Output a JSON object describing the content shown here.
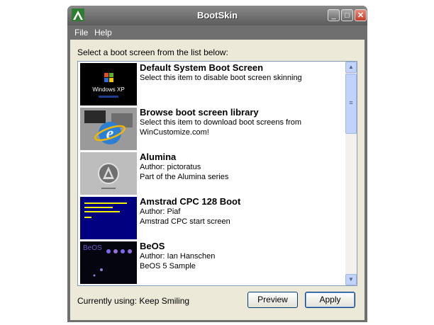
{
  "window": {
    "title": "BootSkin",
    "minimize": "_",
    "maximize": "□",
    "close": "✕"
  },
  "menu": [
    {
      "label": "File"
    },
    {
      "label": "Help"
    }
  ],
  "prompt": "Select a boot screen from the list below:",
  "items": [
    {
      "name": "Default System Boot Screen",
      "lines": [
        "Select this item to disable boot screen skinning"
      ],
      "thumb": "windows-xp-boot-thumbnail",
      "thumb_text": "Windows XP"
    },
    {
      "name": "Browse boot screen library",
      "lines": [
        "Select this item to download boot screens from",
        "WinCustomize.com!"
      ],
      "thumb": "internet-explorer-thumbnail"
    },
    {
      "name": "Alumina",
      "lines": [
        "Author: pictoratus",
        "Part of the Alumina series"
      ],
      "thumb": "alumina-thumbnail"
    },
    {
      "name": "Amstrad CPC 128 Boot",
      "lines": [
        "Author: Piaf",
        "Amstrad CPC start screen"
      ],
      "thumb": "amstrad-thumbnail"
    },
    {
      "name": "BeOS",
      "lines": [
        "Author: Ian Hanschen",
        "BeOS 5 Sample"
      ],
      "thumb": "beos-thumbnail",
      "thumb_text": "BeOS"
    }
  ],
  "status": "Currently using: Keep Smiling",
  "buttons": {
    "preview": "Preview",
    "apply": "Apply"
  },
  "scrollbar": {
    "up": "▲",
    "down": "▼",
    "grip": "≡"
  },
  "colors": {
    "titlebar": "#6f6f6f",
    "client": "#ece9d8",
    "list_border": "#7f9db9",
    "scroll_thumb": "#c1d3fb"
  }
}
